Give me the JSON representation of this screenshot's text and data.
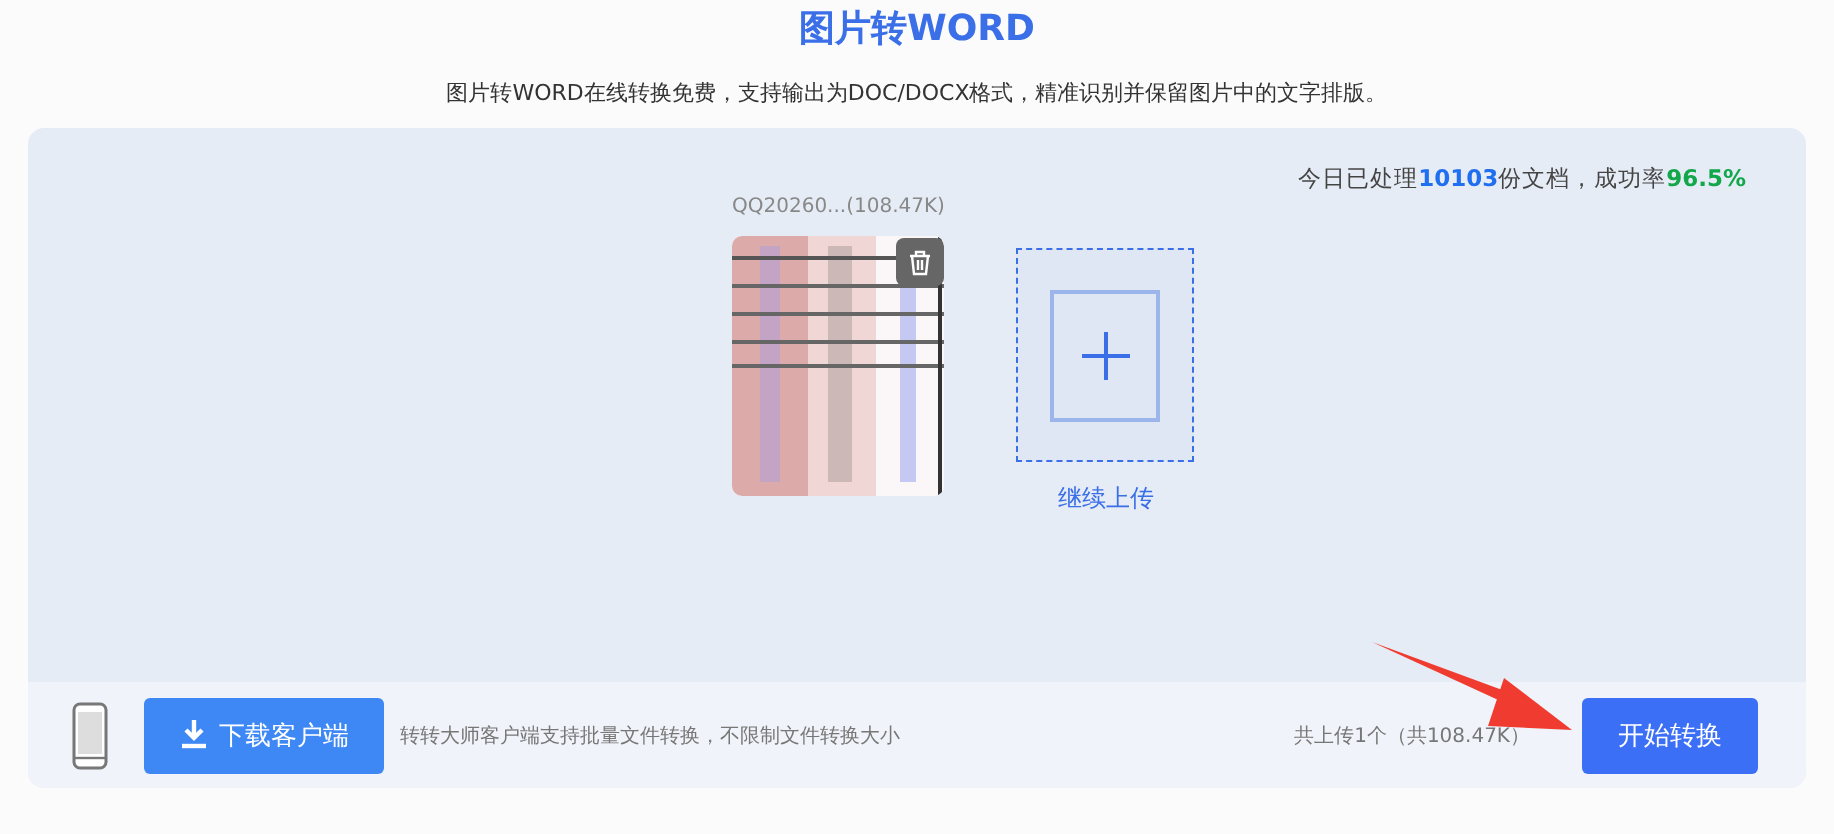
{
  "header": {
    "title": "图片转WORD",
    "subtitle": "图片转WORD在线转换免费，支持输出为DOC/DOCX格式，精准识别并保留图片中的文字排版。"
  },
  "stats": "今日已处理**10103**份文档，成功率**96.5%**",
  "files": [
    {
      "name": "QQ20260...(108.47K)",
      "kind": "picture"
    }
  ],
  "add_more": {
    "label": "继续上传"
  },
  "footer": {
    "download_button": "下载客户端",
    "note": "转转大师客户端支持批量文件转换，不限制文件转换大小",
    "summary": "共上传1个（共108.47K）",
    "start_button": "开始转换"
  }
}
